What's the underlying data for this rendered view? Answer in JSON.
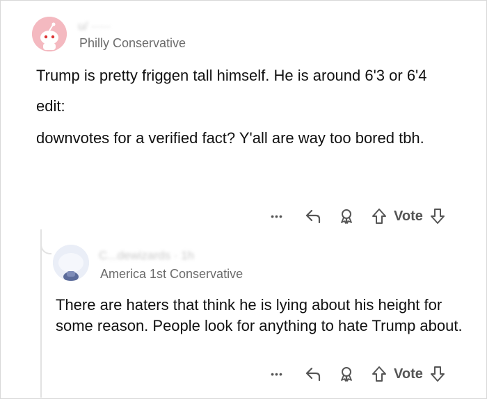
{
  "comments": [
    {
      "username": "u/ ·····",
      "flair": "Philly Conservative",
      "paragraphs": [
        "Trump is pretty friggen tall himself. He is around 6'3 or 6'4",
        "edit:",
        "downvotes for a verified fact? Y'all are way too bored tbh."
      ],
      "actions": {
        "more": "•••",
        "vote_label": "Vote"
      }
    },
    {
      "username": "C...dewizards · 1h",
      "flair": "America 1st Conservative",
      "paragraphs": [
        "There are haters that think he is lying about his height for some reason. People look for anything to hate Trump about."
      ],
      "actions": {
        "more": "•••",
        "vote_label": "Vote"
      }
    }
  ],
  "colors": {
    "avatar1_bg": "#f2b6bd",
    "avatar2_bg": "#e6ebf5",
    "icon": "#555555"
  },
  "icons": [
    "more-icon",
    "reply-icon",
    "award-icon",
    "upvote-icon",
    "downvote-icon"
  ]
}
